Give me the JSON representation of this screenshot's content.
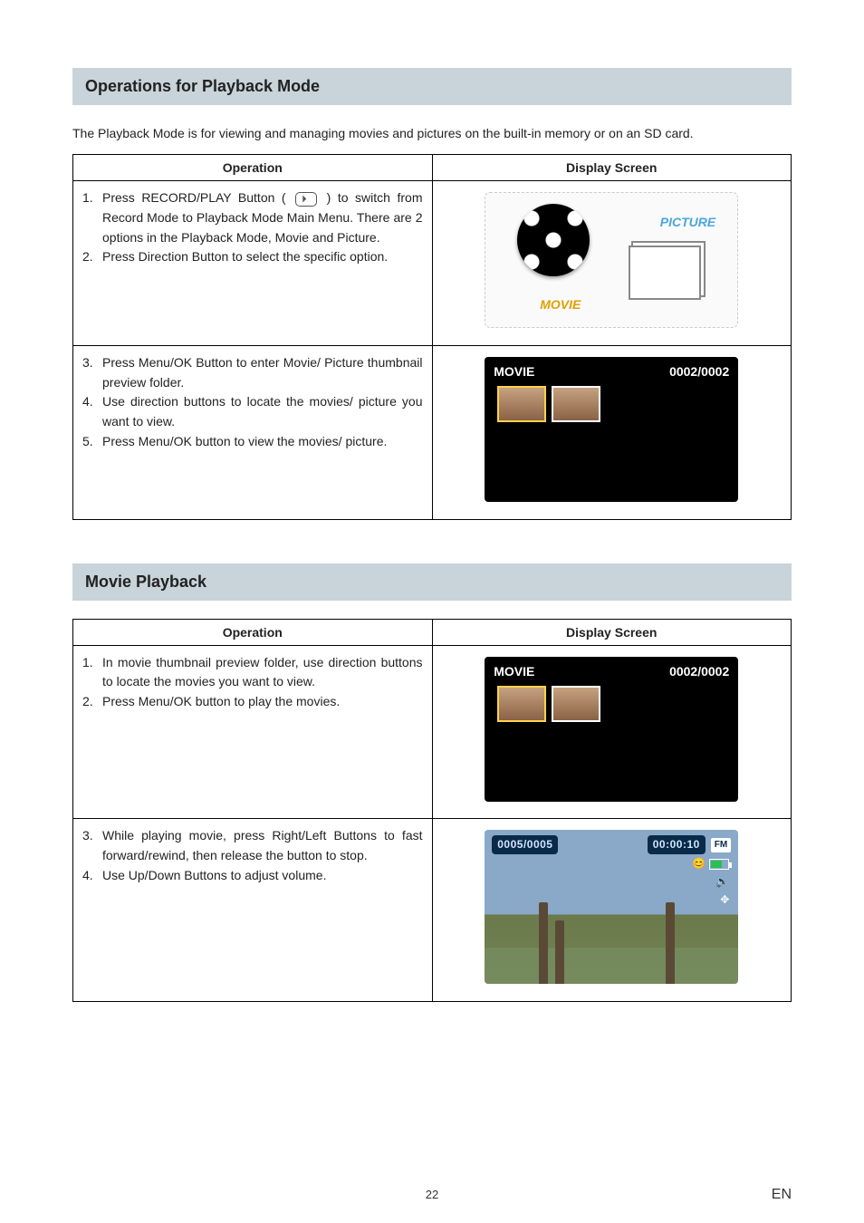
{
  "section1": {
    "title": "Operations for Playback Mode",
    "intro": "The Playback Mode is for viewing and managing movies and pictures on the built-in memory or on an SD card.",
    "col_operation": "Operation",
    "col_display": "Display Screen",
    "row1": {
      "item1_pre": "Press RECORD/PLAY Button ( ",
      "item1_post": " ) to switch from Record Mode to Playback Mode Main Menu. There are 2 options in the Playback Mode, Movie and Picture.",
      "item2": "Press Direction Button to select the specific option.",
      "screen": {
        "movie": "MOVIE",
        "picture": "PICTURE"
      }
    },
    "row2": {
      "item3": "Press Menu/OK Button to enter Movie/ Picture thumbnail preview folder.",
      "item4": "Use direction buttons to locate the movies/ picture you want to view.",
      "item5": "Press Menu/OK button to view the movies/ picture.",
      "screen": {
        "title": "MOVIE",
        "counter": "0002/0002"
      }
    }
  },
  "section2": {
    "title": "Movie Playback",
    "col_operation": "Operation",
    "col_display": "Display Screen",
    "row1": {
      "item1": "In movie thumbnail preview folder, use direction buttons to locate the movies you want to view.",
      "item2": "Press Menu/OK button to play the movies.",
      "screen": {
        "title": "MOVIE",
        "counter": "0002/0002"
      }
    },
    "row2": {
      "item3": "While playing movie, press Right/Left Buttons to fast forward/rewind, then release the button to stop.",
      "item4": "Use Up/Down Buttons to adjust volume.",
      "screen": {
        "counter": "0005/0005",
        "time": "00:00:10",
        "fm": "FM"
      }
    }
  },
  "footer": {
    "page": "22",
    "lang": "EN"
  },
  "nums": {
    "n1": "1.",
    "n2": "2.",
    "n3": "3.",
    "n4": "4.",
    "n5": "5."
  }
}
